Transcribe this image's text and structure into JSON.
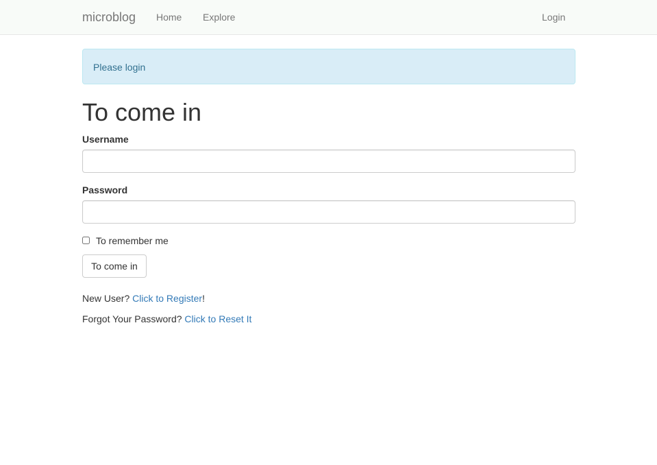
{
  "navbar": {
    "brand": "microblog",
    "home": "Home",
    "explore": "Explore",
    "login": "Login"
  },
  "alert": {
    "message": "Please login"
  },
  "form": {
    "title": "To come in",
    "username_label": "Username",
    "username_value": "",
    "password_label": "Password",
    "password_value": "",
    "remember_label": "To remember me",
    "submit_label": "To come in"
  },
  "links": {
    "new_user_text": "New User?",
    "register_link": "Click to Register",
    "register_suffix": "!",
    "forgot_text": "Forgot Your Password?",
    "reset_link": "Click to Reset It"
  }
}
